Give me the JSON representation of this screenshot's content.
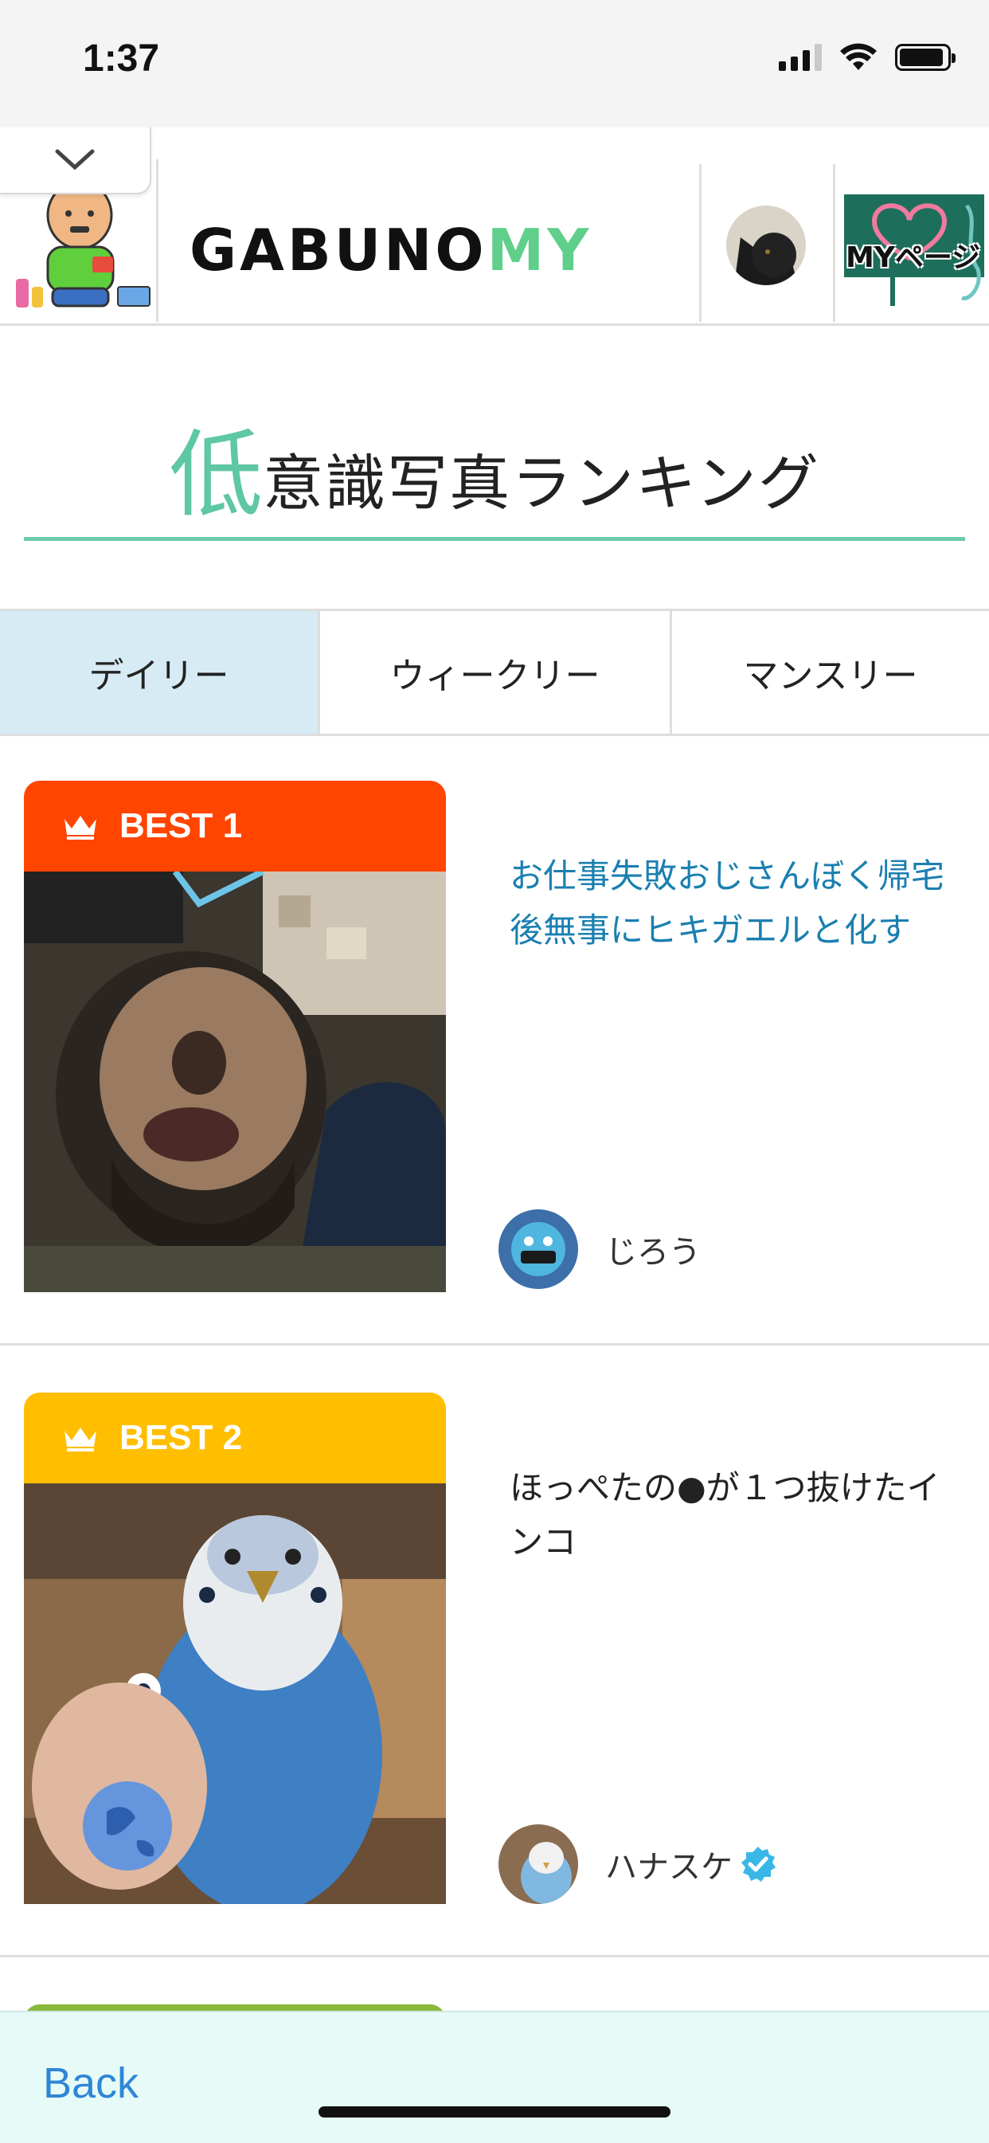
{
  "status_bar": {
    "time": "1:37"
  },
  "header": {
    "logo_black": "GABUNO",
    "logo_green": "MY",
    "mypage_label": "MYページ"
  },
  "page": {
    "title_big": "低",
    "title_rest": "意識写真ランキング"
  },
  "tabs": [
    {
      "label": "デイリー",
      "active": true
    },
    {
      "label": "ウィークリー",
      "active": false
    },
    {
      "label": "マンスリー",
      "active": false
    }
  ],
  "ranking": [
    {
      "badge": "BEST 1",
      "badge_color": "#ff4500",
      "title": "お仕事失敗おじさんぼく帰宅後無事にヒキガエルと化す",
      "user": "じろう",
      "verified": false
    },
    {
      "badge": "BEST 2",
      "badge_color": "#ffbe00",
      "title": "ほっぺたの●が１つ抜けたインコ",
      "user": "ハナスケ",
      "verified": true
    }
  ],
  "next_badge_color": "#8ab83a",
  "accent_color": "#5ec7a3",
  "bottom_bar": {
    "back_label": "Back"
  }
}
